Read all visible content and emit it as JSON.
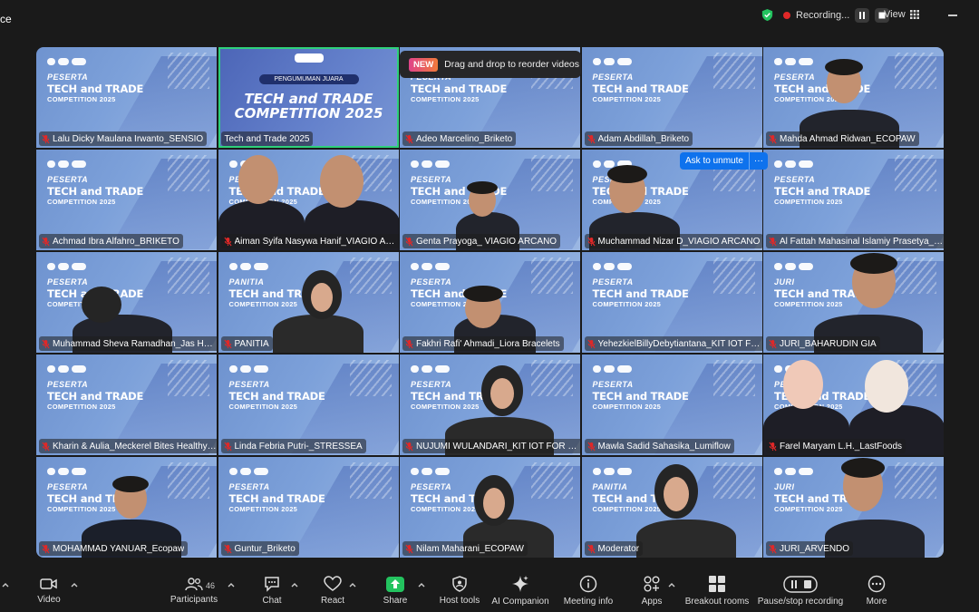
{
  "window": {
    "title_fragment": "ce"
  },
  "topbar": {
    "recording_label": "Recording...",
    "view_label": "View"
  },
  "toast": {
    "badge": "NEW",
    "text": "Drag and drop to reorder videos"
  },
  "unmute": {
    "label": "Ask to unmute",
    "more": "···"
  },
  "slide": {
    "role_peserta": "PESERTA",
    "role_panitia": "PANITIA",
    "role_juri": "JURI",
    "line1": "TECH and TRADE",
    "line2": "COMPETITION 2025",
    "feature_pill": "PENGUMUMAN JUARA",
    "feature_line1": "TECH and TRADE",
    "feature_line2": "COMPETITION 2025"
  },
  "participants": [
    {
      "name": "Lalu Dicky Maulana Irwanto_SENSIO",
      "role": "PESERTA"
    },
    {
      "name": "Tech and Trade 2025",
      "role": "FEATURE"
    },
    {
      "name": "Adeo Marcelino_Briketo",
      "role": "PESERTA"
    },
    {
      "name": "Adam Abdillah_Briketo",
      "role": "PESERTA"
    },
    {
      "name": "Mahda Ahmad Ridwan_ECOPAW",
      "role": "PESERTA"
    },
    {
      "name": "Achmad Ibra Alfahro_BRIKETO",
      "role": "PESERTA"
    },
    {
      "name": "Aiman Syifa Nasywa Hanif_VIAGIO ARC...",
      "role": "PESERTA"
    },
    {
      "name": "Genta Prayoga_ VIAGIO ARCANO",
      "role": "PESERTA"
    },
    {
      "name": "Muchammad Nizar D_VIAGIO ARCANO",
      "role": "PESERTA"
    },
    {
      "name": "Al Fattah Mahasinal Islamiy Prasetya_Lu...",
      "role": "PESERTA"
    },
    {
      "name": "Muhammad Sheva Ramadhan_Jas Huja...",
      "role": "PESERTA"
    },
    {
      "name": "PANITIA",
      "role": "PANITIA"
    },
    {
      "name": "Fakhri Rafi' Ahmadi_Liora Bracelets",
      "role": "PESERTA"
    },
    {
      "name": "YehezkielBillyDebytiantana_KIT IOT FOR ...",
      "role": "PESERTA"
    },
    {
      "name": "JURI_BAHARUDIN GIA",
      "role": "JURI"
    },
    {
      "name": "Kharin & Aulia_Meckerel Bites Healthy C...",
      "role": "PESERTA"
    },
    {
      "name": "Linda Febria Putri-_STRESSEA",
      "role": "PESERTA"
    },
    {
      "name": "NUJUMI WULANDARI_KIT IOT FOR EDU...",
      "role": "PESERTA"
    },
    {
      "name": "Mawla Sadid Sahasika_Lumiflow",
      "role": "PESERTA"
    },
    {
      "name": "Farel Maryam L.H._LastFoods",
      "role": "PESERTA"
    },
    {
      "name": "MOHAMMAD YANUAR_Ecopaw",
      "role": "PESERTA"
    },
    {
      "name": "Guntur_Briketo",
      "role": "PESERTA"
    },
    {
      "name": "Nilam Maharani_ECOPAW",
      "role": "PESERTA"
    },
    {
      "name": "Moderator",
      "role": "PANITIA"
    },
    {
      "name": "JURI_ARVENDO",
      "role": "JURI"
    }
  ],
  "toolbar": {
    "video": "Video",
    "participants": "Participants",
    "participant_count": "46",
    "chat": "Chat",
    "react": "React",
    "share": "Share",
    "host_tools": "Host tools",
    "ai_companion": "AI Companion",
    "meeting_info": "Meeting info",
    "apps": "Apps",
    "breakout_rooms": "Breakout rooms",
    "pause_stop_recording": "Pause/stop recording",
    "more": "More"
  },
  "colors": {
    "active_speaker": "#2fd07b",
    "share_green": "#23c35f",
    "unmute_blue": "#0e72ed",
    "mic_red": "#e02828"
  }
}
